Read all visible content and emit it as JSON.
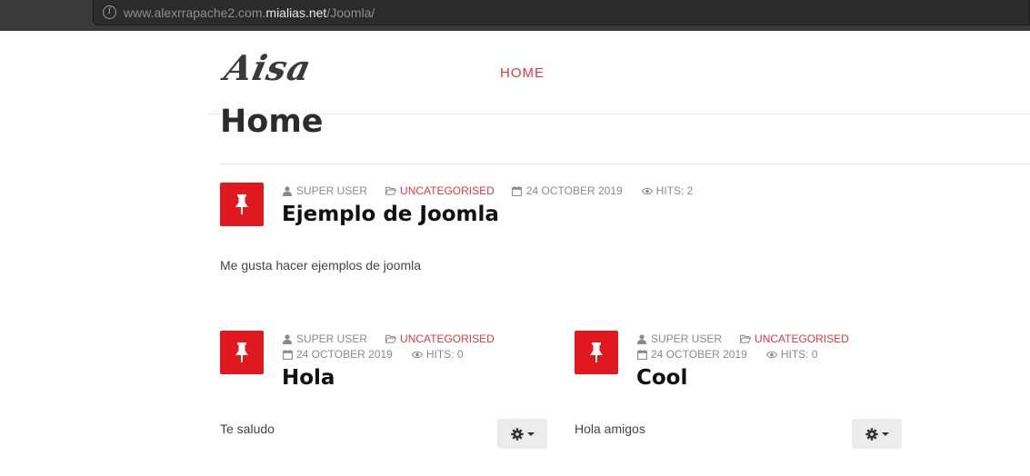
{
  "browser": {
    "url_prefix": "www.alexrrapache2.com.",
    "url_domain": "mialias.net",
    "url_path": "/Joomla/"
  },
  "site": {
    "logo": "Aisa",
    "nav": {
      "home": "HOME"
    }
  },
  "page": {
    "title": "Home"
  },
  "articles": [
    {
      "author": "SUPER USER",
      "category": "UNCATEGORISED",
      "date": "24 OCTOBER 2019",
      "hits": "HITS: 2",
      "title": "Ejemplo de Joomla",
      "body": "Me gusta hacer ejemplos de joomla"
    },
    {
      "author": "SUPER USER",
      "category": "UNCATEGORISED",
      "date": "24 OCTOBER 2019",
      "hits": "HITS: 0",
      "title": "Hola",
      "body": "Te saludo"
    },
    {
      "author": "SUPER USER",
      "category": "UNCATEGORISED",
      "date": "24 OCTOBER 2019",
      "hits": "HITS: 0",
      "title": "Cool",
      "body": "Hola amigos"
    }
  ],
  "colors": {
    "accent": "#e0393e",
    "pin_bg": "#e0191e",
    "browser_bar": "#2b2b2b"
  },
  "icons": [
    "info-icon",
    "pin-icon",
    "user-icon",
    "folder-icon",
    "calendar-icon",
    "eye-icon",
    "gear-icon",
    "caret-down-icon"
  ]
}
